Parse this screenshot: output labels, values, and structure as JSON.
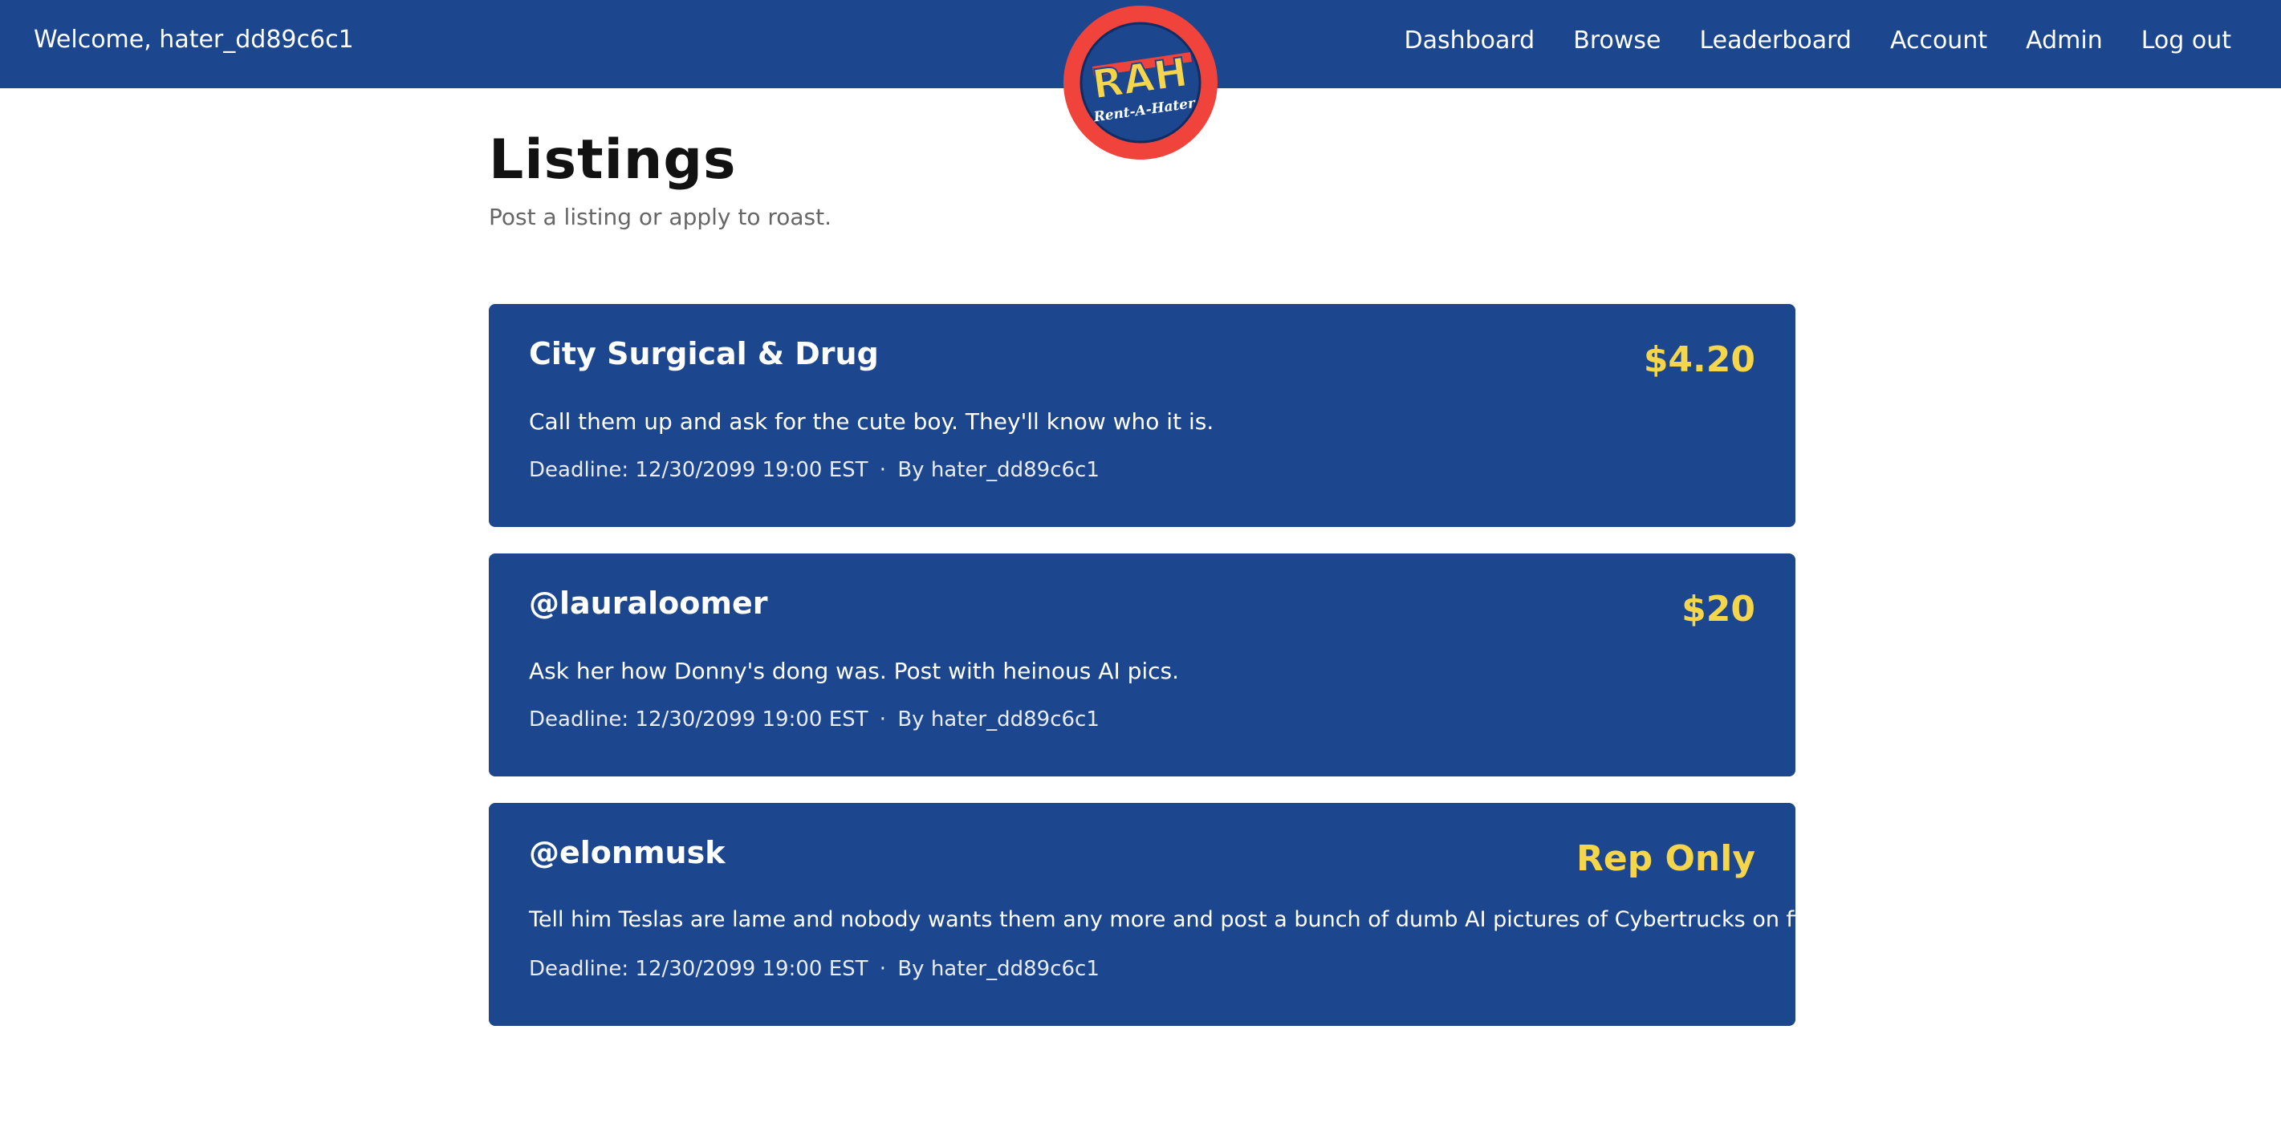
{
  "header": {
    "welcome": "Welcome, hater_dd89c6c1",
    "nav": [
      "Dashboard",
      "Browse",
      "Leaderboard",
      "Account",
      "Admin",
      "Log out"
    ],
    "logo": {
      "top_text": "RAH",
      "bottom_text": "Rent-A-Hater",
      "ring_color": "#f0433b",
      "inner_color": "#1c468e",
      "accent_color": "#f5d54a"
    }
  },
  "page": {
    "title": "Listings",
    "subtitle": "Post a listing or apply to roast."
  },
  "listings": [
    {
      "title": "City Surgical & Drug",
      "price": "$4.20",
      "description": "Call them up and ask for the cute boy. They'll know who it is.",
      "deadline": "Deadline: 12/30/2099 19:00 EST",
      "separator": "·",
      "author": "By hater_dd89c6c1"
    },
    {
      "title": "@lauraloomer",
      "price": "$20",
      "description": "Ask her how Donny's dong was. Post with heinous AI pics.",
      "deadline": "Deadline: 12/30/2099 19:00 EST",
      "separator": "·",
      "author": "By hater_dd89c6c1"
    },
    {
      "title": "@elonmusk",
      "price": "Rep Only",
      "description": "Tell him Teslas are lame and nobody wants them any more and post a bunch of dumb AI pictures of Cybertrucks on fire.",
      "deadline": "Deadline: 12/30/2099 19:00 EST",
      "separator": "·",
      "author": "By hater_dd89c6c1"
    }
  ],
  "colors": {
    "brand_blue": "#1c468e",
    "price_yellow": "#f5d54a",
    "logo_red": "#f0433b"
  }
}
